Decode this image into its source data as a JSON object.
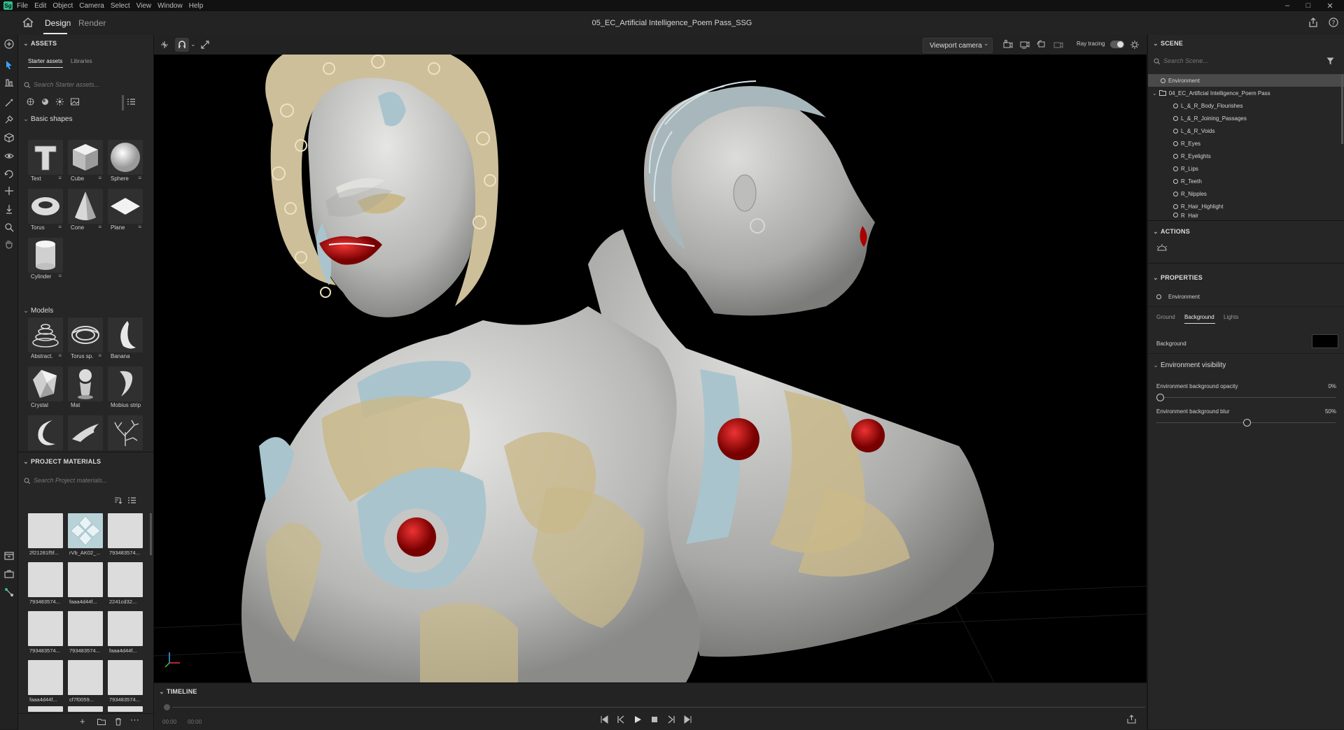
{
  "menubar": {
    "app_icon": "Sg",
    "items": [
      "File",
      "Edit",
      "Object",
      "Camera",
      "Select",
      "View",
      "Window",
      "Help"
    ]
  },
  "titlebar": {
    "tabs": [
      "Design",
      "Render"
    ],
    "active_tab": "Design",
    "document_title": "05_EC_Artificial Intelligence_Poem Pass_SSG"
  },
  "assets": {
    "header": "ASSETS",
    "tabs": [
      "Starter assets",
      "Libraries"
    ],
    "search_placeholder": "Search Starter assets...",
    "basic_shapes": {
      "title": "Basic shapes",
      "items": [
        "Text",
        "Cube",
        "Sphere",
        "Torus",
        "Cone",
        "Plane",
        "Cylinder"
      ]
    },
    "models": {
      "title": "Models",
      "items": [
        "Abstract...",
        "Torus sp...",
        "Banana",
        "Crystal",
        "Mat",
        "Mobius strip"
      ]
    }
  },
  "project_materials": {
    "header": "PROJECT MATERIALS",
    "search_placeholder": "Search Project materials...",
    "items": [
      "2f21281f5f...",
      "rVb_AK02_...",
      "793483574...",
      "793483574...",
      "faaa4d44f...",
      "2241cd32...",
      "793483574...",
      "793483574...",
      "faaa4d44f...",
      "faaa4d44f...",
      "cf7f0059...",
      "793483574..."
    ]
  },
  "viewport": {
    "camera_select": "Viewport camera",
    "ray_tracing_label": "Ray tracing"
  },
  "timeline": {
    "header": "TIMELINE",
    "time_start": "00:00",
    "time_end": "00:00"
  },
  "scene": {
    "header": "SCENE",
    "search_placeholder": "Search Scene...",
    "environment": "Environment",
    "group": "04_EC_Artificial Intelligence_Poem Pass",
    "children": [
      "L_&_R_Body_Flourishes",
      "L_&_R_Joining_Passages",
      "L_&_R_Voids",
      "R_Eyes",
      "R_Eyelights",
      "R_Lips",
      "R_Teeth",
      "R_Nipples",
      "R_Hair_Highlight",
      "R_Hair"
    ]
  },
  "actions": {
    "header": "ACTIONS"
  },
  "properties": {
    "header": "PROPERTIES",
    "selected": "Environment",
    "tabs": [
      "Ground",
      "Background",
      "Lights"
    ],
    "active_tab": "Background",
    "background_label": "Background",
    "background_color": "#000000",
    "visibility_title": "Environment visibility",
    "opacity_label": "Environment background opacity",
    "opacity_value": "0%",
    "opacity_level": 0,
    "blur_label": "Environment background blur",
    "blur_value": "50%",
    "blur_level": 0.5
  },
  "colors": {
    "accent": "#2bbf8f",
    "lips": "#b01010",
    "gold": "#c9b98a",
    "silver": "#a9c4cc"
  }
}
